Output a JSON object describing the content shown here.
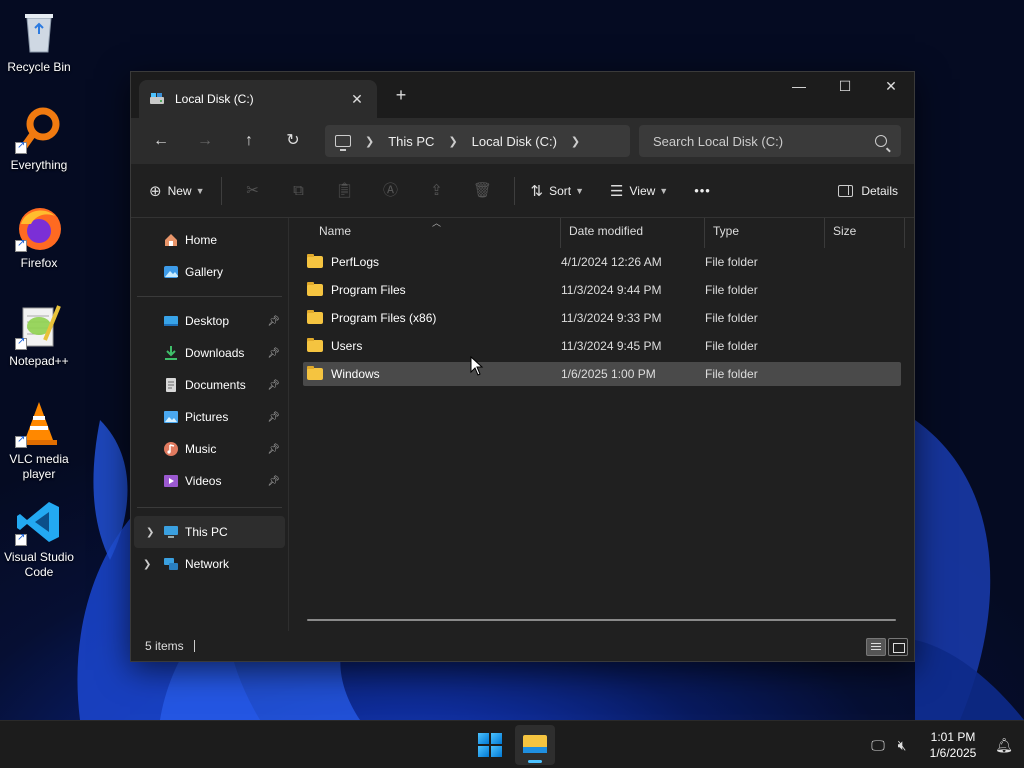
{
  "desktop": {
    "icons": [
      {
        "label": "Recycle Bin"
      },
      {
        "label": "Everything"
      },
      {
        "label": "Firefox"
      },
      {
        "label": "Notepad++"
      },
      {
        "label": "VLC media player"
      },
      {
        "label": "Visual Studio Code"
      }
    ]
  },
  "window": {
    "tab_title": "Local Disk (C:)",
    "close_tab": "✕",
    "new_tab": "+",
    "controls": {
      "minimize": "—",
      "maximize": "☐",
      "close": "✕"
    }
  },
  "navbar": {
    "back": "←",
    "forward": "→",
    "up": "↑",
    "refresh": "↻",
    "breadcrumb": [
      "This PC",
      "Local Disk (C:)"
    ],
    "search_placeholder": "Search Local Disk (C:)"
  },
  "cmdbar": {
    "new_label": "New",
    "sort_label": "Sort",
    "view_label": "View",
    "more": "•••",
    "details_label": "Details"
  },
  "sidebar": {
    "items": [
      {
        "label": "Home"
      },
      {
        "label": "Gallery"
      },
      {
        "label": "Desktop"
      },
      {
        "label": "Downloads"
      },
      {
        "label": "Documents"
      },
      {
        "label": "Pictures"
      },
      {
        "label": "Music"
      },
      {
        "label": "Videos"
      },
      {
        "label": "This PC"
      },
      {
        "label": "Network"
      }
    ]
  },
  "columns": {
    "name": "Name",
    "date": "Date modified",
    "type": "Type",
    "size": "Size"
  },
  "files": [
    {
      "name": "PerfLogs",
      "date": "4/1/2024 12:26 AM",
      "type": "File folder"
    },
    {
      "name": "Program Files",
      "date": "11/3/2024 9:44 PM",
      "type": "File folder"
    },
    {
      "name": "Program Files (x86)",
      "date": "11/3/2024 9:33 PM",
      "type": "File folder"
    },
    {
      "name": "Users",
      "date": "11/3/2024 9:45 PM",
      "type": "File folder"
    },
    {
      "name": "Windows",
      "date": "1/6/2025 1:00 PM",
      "type": "File folder"
    }
  ],
  "status": {
    "items": "5 items"
  },
  "taskbar": {
    "time": "1:01 PM",
    "date": "1/6/2025"
  },
  "colors": {
    "accent": "#4cc2ff",
    "folder": "#f5c440",
    "window_bg": "#202020"
  }
}
